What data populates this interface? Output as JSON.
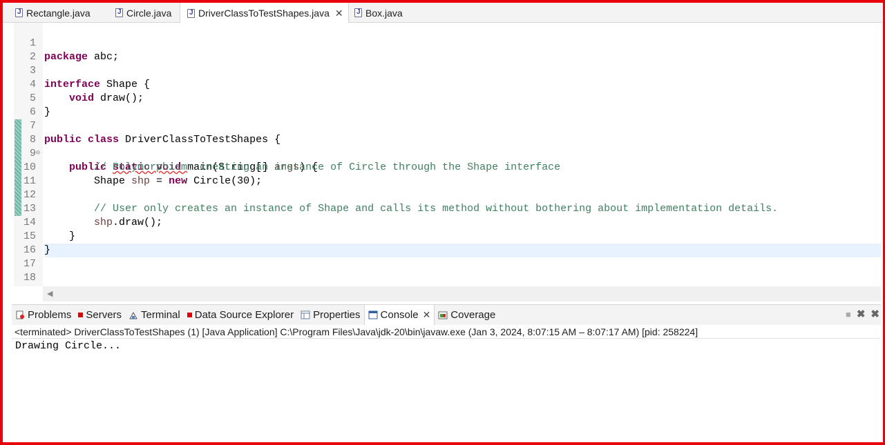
{
  "editor_tabs": [
    {
      "label": "Rectangle.java",
      "active": false
    },
    {
      "label": "Circle.java",
      "active": false
    },
    {
      "label": "DriverClassToTestShapes.java",
      "active": true
    },
    {
      "label": "Box.java",
      "active": false
    }
  ],
  "code_lines": [
    {
      "n": "1"
    },
    {
      "n": "2"
    },
    {
      "n": "3"
    },
    {
      "n": "4"
    },
    {
      "n": "5"
    },
    {
      "n": "6"
    },
    {
      "n": "7"
    },
    {
      "n": "8"
    },
    {
      "n": "9"
    },
    {
      "n": "10"
    },
    {
      "n": "11"
    },
    {
      "n": "12"
    },
    {
      "n": "13"
    },
    {
      "n": "14"
    },
    {
      "n": "15"
    },
    {
      "n": "16"
    },
    {
      "n": "17"
    },
    {
      "n": "18"
    }
  ],
  "code": {
    "l1_kw": "package",
    "l1_rest": " abc;",
    "l3_kw": "interface",
    "l3_rest": " Shape {",
    "l4_kw": "void",
    "l4_rest": " draw();",
    "l5": "}",
    "l7_kw1": "public",
    "l7_kw2": "class",
    "l7_rest": " DriverClassToTestShapes {",
    "l8_kw1": "public",
    "l8_kw2": "static",
    "l8_kw3": "void",
    "l8_rest": " main(String[] ",
    "l8_arg": "args",
    "l8_end": ") {",
    "l9_pre": "// ",
    "l9_wavy": "Polymorphism",
    "l9_rest": ": creating an instance of Circle through the Shape interface",
    "l10_a": "Shape ",
    "l10_var": "shp",
    "l10_b": " = ",
    "l10_kw": "new",
    "l10_c": " Circle(30);",
    "l12": "// User only creates an instance of Shape and calls its method without bothering about implementation details.",
    "l13_var": "shp",
    "l13_rest": ".draw();",
    "l14": "}",
    "l15": "}"
  },
  "panel_tabs": [
    {
      "label": "Problems"
    },
    {
      "label": "Servers"
    },
    {
      "label": "Terminal"
    },
    {
      "label": "Data Source Explorer"
    },
    {
      "label": "Properties"
    },
    {
      "label": "Console"
    },
    {
      "label": "Coverage"
    }
  ],
  "console": {
    "status": "<terminated> DriverClassToTestShapes (1) [Java Application] C:\\Program Files\\Java\\jdk-20\\bin\\javaw.exe  (Jan 3, 2024, 8:07:15 AM – 8:07:17 AM) [pid: 258224]",
    "output": "Drawing Circle..."
  },
  "colors": {
    "frame": "#e8000b",
    "keyword": "#7f0055",
    "comment": "#3f7f5f",
    "variable": "#6a3e3e"
  }
}
